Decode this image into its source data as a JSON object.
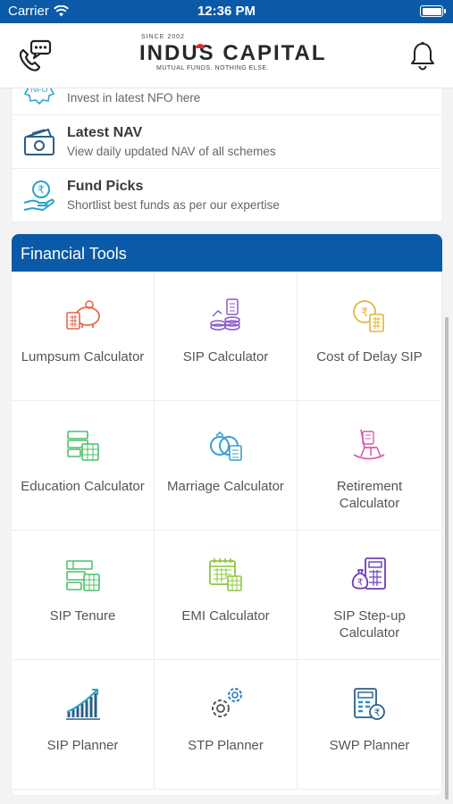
{
  "status_bar": {
    "carrier": "Carrier",
    "time": "12:36 PM"
  },
  "brand": {
    "since": "SINCE 2002",
    "name": "INDUS CAPITAL",
    "tagline": "MUTUAL FUNDS. NOTHING ELSE."
  },
  "quick_links": [
    {
      "title": "",
      "subtitle": "Invest in latest NFO here",
      "icon": "nfo-icon"
    },
    {
      "title": "Latest NAV",
      "subtitle": "View daily updated NAV of all schemes",
      "icon": "nav-cash-icon"
    },
    {
      "title": "Fund Picks",
      "subtitle": "Shortlist best funds as per our expertise",
      "icon": "fund-picks-icon"
    }
  ],
  "financial_tools": {
    "title": "Financial Tools",
    "items": [
      {
        "label": "Lumpsum Calculator",
        "icon": "piggy-bank-calculator-icon"
      },
      {
        "label": "SIP Calculator",
        "icon": "coins-icon"
      },
      {
        "label": "Cost of Delay SIP",
        "icon": "rupee-coin-calculator-icon"
      },
      {
        "label": "Education Calculator",
        "icon": "education-calculator-icon"
      },
      {
        "label": "Marriage Calculator",
        "icon": "rings-icon"
      },
      {
        "label": "Retirement Calculator",
        "icon": "rocking-chair-icon"
      },
      {
        "label": "SIP Tenure",
        "icon": "sip-tenure-icon"
      },
      {
        "label": "EMI Calculator",
        "icon": "calendar-calculator-icon"
      },
      {
        "label": "SIP Step-up Calculator",
        "icon": "moneybag-calculator-icon"
      },
      {
        "label": "SIP Planner",
        "icon": "growth-chart-icon"
      },
      {
        "label": "STP Planner",
        "icon": "gears-icon"
      },
      {
        "label": "SWP Planner",
        "icon": "calculator-rupee-icon"
      }
    ]
  },
  "colors": {
    "brand_blue": "#0a5aa8",
    "accent_red": "#e22b2b"
  }
}
